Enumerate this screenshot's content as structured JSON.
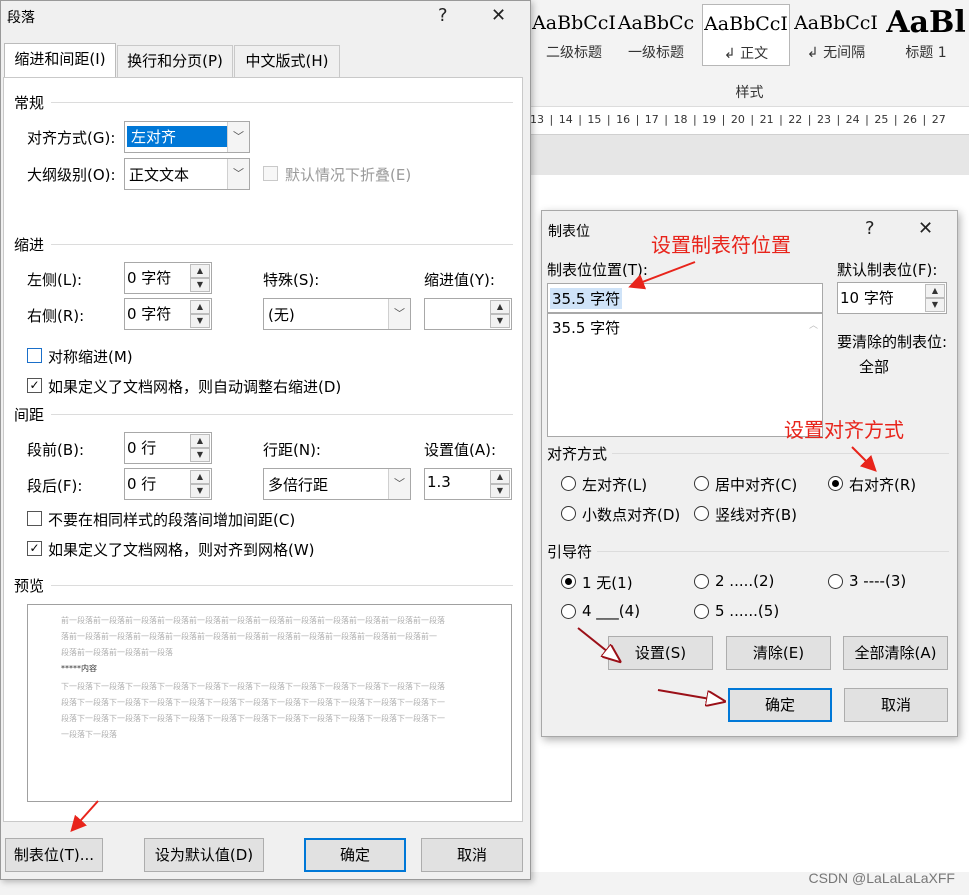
{
  "ribbon": {
    "styles": [
      {
        "sample": "AaBbCcI",
        "name": "二级标题",
        "selected": false
      },
      {
        "sample": "AaBbCc",
        "name": "一级标题",
        "selected": false
      },
      {
        "sample": "AaBbCcI",
        "name": "↲ 正文",
        "selected": true
      },
      {
        "sample": "AaBbCcI",
        "name": "↲ 无间隔",
        "selected": false
      },
      {
        "sample": "AaBl",
        "name": "标题 1",
        "selected": false
      }
    ],
    "group_label": "样式",
    "ruler": "13 | 14 | 15 | 16 | 17 | 18 | 19 | 20 | 21 | 22 | 23 | 24 | 25 | 26 | 27"
  },
  "paragraph_dialog": {
    "title": "段落",
    "help": "?",
    "close": "✕",
    "tabs": [
      "缩进和间距(I)",
      "换行和分页(P)",
      "中文版式(H)"
    ],
    "general": {
      "heading": "常规",
      "alignment_label": "对齐方式(G):",
      "alignment_value": "左对齐",
      "outline_label": "大纲级别(O):",
      "outline_value": "正文文本",
      "collapse_label": "默认情况下折叠(E)"
    },
    "indent": {
      "heading": "缩进",
      "left_label": "左侧(L):",
      "left_value": "0 字符",
      "right_label": "右侧(R):",
      "right_value": "0 字符",
      "special_label": "特殊(S):",
      "special_value": "(无)",
      "by_label": "缩进值(Y):",
      "by_value": "",
      "mirror_label": "对称缩进(M)",
      "auto_adjust_label": "如果定义了文档网格，则自动调整右缩进(D)"
    },
    "spacing": {
      "heading": "间距",
      "before_label": "段前(B):",
      "before_value": "0 行",
      "after_label": "段后(F):",
      "after_value": "0 行",
      "line_label": "行距(N):",
      "line_value": "多倍行距",
      "at_label": "设置值(A):",
      "at_value": "1.3",
      "no_space_label": "不要在相同样式的段落间增加间距(C)",
      "snap_grid_label": "如果定义了文档网格，则对齐到网格(W)"
    },
    "preview": {
      "heading": "预览",
      "lines": [
        "前一段落前一段落前一段落前一段落前一段落前一段落前一段落前一段落前一段落前一段落前一段落前一段落",
        "落前一段落前一段落前一段落前一段落前一段落前一段落前一段落前一段落前一段落前一段落前一段落前一",
        "段落前一段落前一段落前一段落",
        "*****内容",
        "下一段落下一段落下一段落下一段落下一段落下一段落下一段落下一段落下一段落下一段落下一段落下一段落",
        "段落下一段落下一段落下一段落下一段落下一段落下一段落下一段落下一段落下一段落下一段落下一段落下一",
        "段落下一段落下一段落下一段落下一段落下一段落下一段落下一段落下一段落下一段落下一段落下一段落下一",
        "一段落下一段落"
      ]
    },
    "buttons": {
      "tabs": "制表位(T)...",
      "set_default": "设为默认值(D)",
      "ok": "确定",
      "cancel": "取消"
    }
  },
  "tab_dialog": {
    "title": "制表位",
    "help": "?",
    "close": "✕",
    "position_label": "制表位位置(T):",
    "position_value": "35.5 字符",
    "list_items": [
      "35.5 字符"
    ],
    "default_label": "默认制表位(F):",
    "default_value": "10 字符",
    "clear_label": "要清除的制表位:",
    "clear_value": "全部",
    "alignment_heading": "对齐方式",
    "alignment_options": [
      {
        "label": "左对齐(L)",
        "checked": false
      },
      {
        "label": "居中对齐(C)",
        "checked": false
      },
      {
        "label": "右对齐(R)",
        "checked": true
      },
      {
        "label": "小数点对齐(D)",
        "checked": false
      },
      {
        "label": "竖线对齐(B)",
        "checked": false
      }
    ],
    "leader_heading": "引导符",
    "leader_options": [
      {
        "label": "1 无(1)",
        "checked": true
      },
      {
        "label": "2 .....(2)",
        "checked": false
      },
      {
        "label": "3 ----(3)",
        "checked": false
      },
      {
        "label": "4 ___(4)",
        "checked": false
      },
      {
        "label": "5 ......(5)",
        "checked": false
      }
    ],
    "buttons": {
      "set": "设置(S)",
      "clear": "清除(E)",
      "clear_all": "全部清除(A)",
      "ok": "确定",
      "cancel": "取消"
    }
  },
  "annotations": {
    "set_position": "设置制表符位置",
    "set_alignment": "设置对齐方式",
    "color": "#e8241b"
  },
  "watermark": "CSDN @LaLaLaLaXFF",
  "colors": {
    "accent": "#0078d7",
    "dialog_bg": "#f0f0f0",
    "annotation": "#e8241b"
  }
}
